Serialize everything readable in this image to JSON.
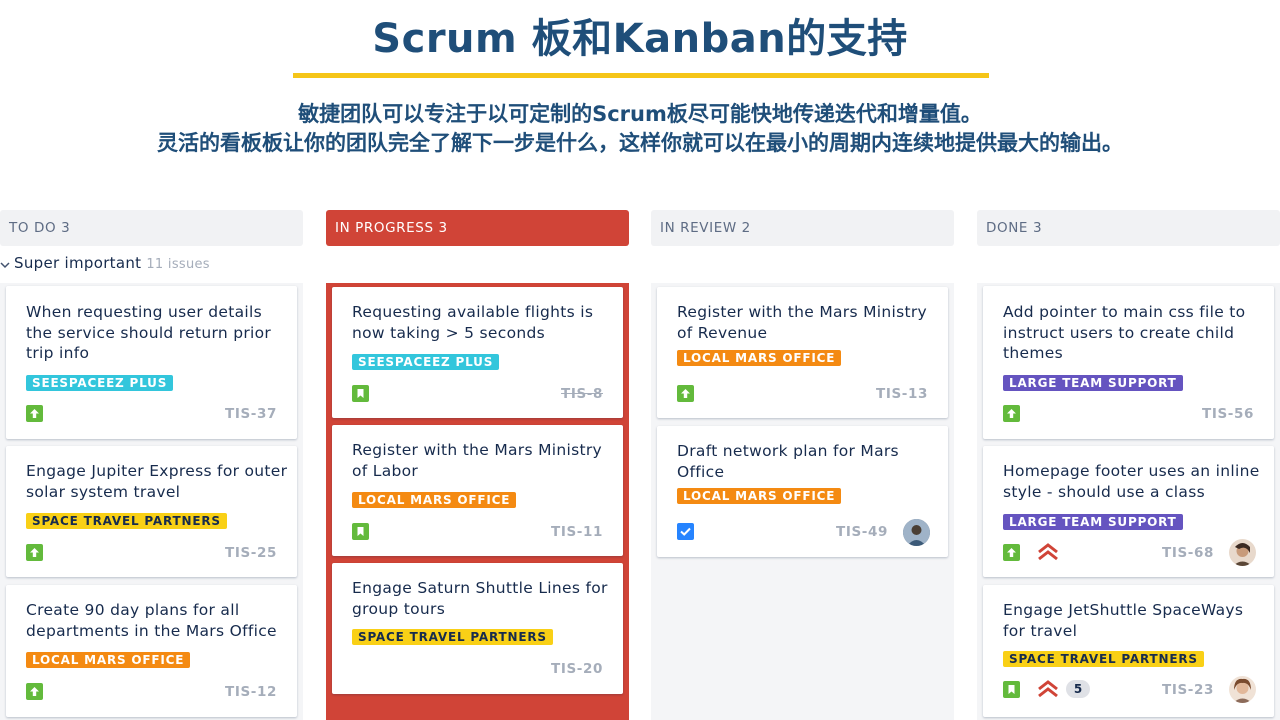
{
  "header": {
    "title": "Scrum 板和Kanban的支持",
    "subtitle1": "敏捷团队可以专注于以可定制的Scrum板尽可能快地传递迭代和增量值。",
    "subtitle2": "灵活的看板板让你的团队完全了解下一步是什么，这样你就可以在最小的周期内连续地提供最大的输出。"
  },
  "colors": {
    "active_column": "#d04437",
    "heading": "#1f4e79",
    "underline": "#f5c518"
  },
  "swimlane": {
    "label": "Super important",
    "count": "11 issues"
  },
  "columns": [
    {
      "header": "TO DO 3"
    },
    {
      "header": "IN PROGRESS  3"
    },
    {
      "header": "IN REVIEW 2"
    },
    {
      "header": "DONE 3"
    }
  ],
  "cards": {
    "todo": [
      {
        "title": "When requesting user details the service should return prior trip info",
        "label": "SEESPACEEZ PLUS",
        "type": "story-improvement-icon",
        "key": "TIS-37"
      },
      {
        "title": "Engage Jupiter Express for outer solar system travel",
        "label": "SPACE TRAVEL PARTNERS",
        "type": "story-improvement-icon",
        "key": "TIS-25"
      },
      {
        "title": "Create 90 day plans for all departments in the Mars Office",
        "label": "LOCAL MARS OFFICE",
        "type": "story-improvement-icon",
        "key": "TIS-12"
      }
    ],
    "inprogress": [
      {
        "title": "Requesting available flights is now taking > 5 seconds",
        "label": "SEESPACEEZ PLUS",
        "type": "story-bookmark-icon",
        "key": "TIS-8"
      },
      {
        "title": "Register with the Mars Ministry of Labor",
        "label": "LOCAL MARS OFFICE",
        "type": "story-bookmark-icon",
        "key": "TIS-11"
      },
      {
        "title": "Engage Saturn Shuttle Lines for group tours",
        "label": "SPACE TRAVEL PARTNERS",
        "key": "TIS-20"
      }
    ],
    "inreview": [
      {
        "title": "Register with the Mars Ministry of Revenue",
        "label": "LOCAL MARS OFFICE",
        "type": "story-improvement-icon",
        "key": "TIS-13"
      },
      {
        "title": "Draft network plan for Mars Office",
        "label": "LOCAL MARS OFFICE",
        "type": "task-checkbox-icon",
        "key": "TIS-49",
        "avatar": "user-avatar"
      }
    ],
    "done": [
      {
        "title": "Add pointer to main css file to instruct users to create child themes",
        "label": "LARGE TEAM SUPPORT",
        "type": "story-improvement-icon",
        "key": "TIS-56"
      },
      {
        "title": "Homepage footer uses an inline style - should use a class",
        "label": "LARGE TEAM SUPPORT",
        "type": "story-improvement-icon",
        "priority": "highest-priority-icon",
        "key": "TIS-68",
        "avatar": "user-avatar"
      },
      {
        "title": "Engage JetShuttle SpaceWays for travel",
        "label": "SPACE TRAVEL PARTNERS",
        "type": "story-bookmark-icon",
        "priority": "highest-priority-icon",
        "votes": "5",
        "key": "TIS-23",
        "avatar": "user-avatar"
      }
    ]
  }
}
